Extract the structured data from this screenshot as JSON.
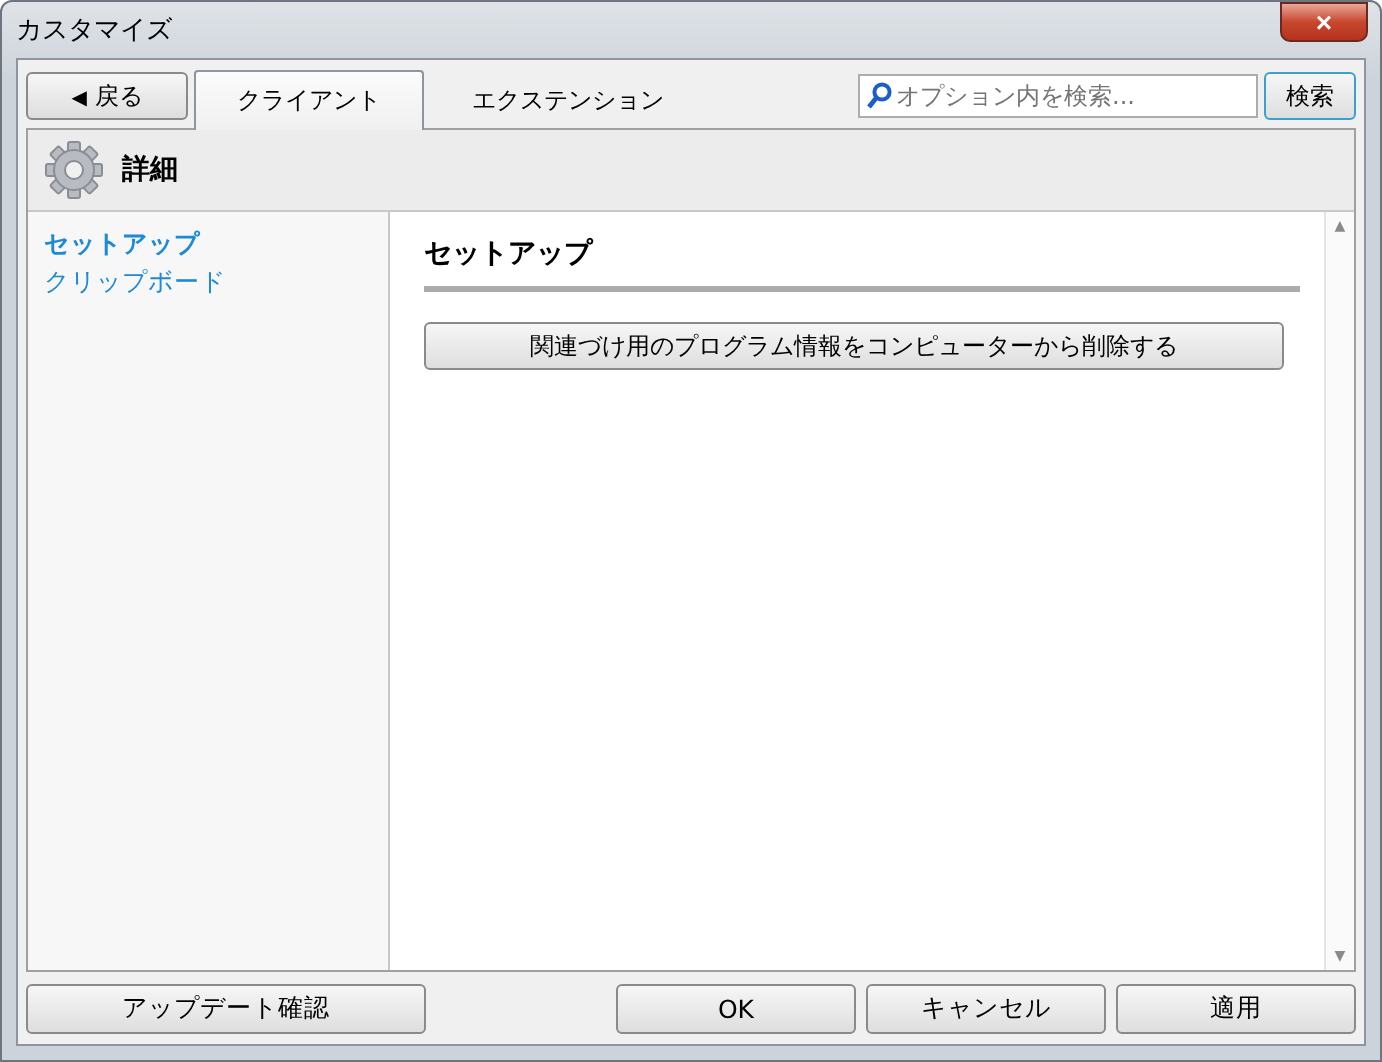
{
  "window": {
    "title": "カスタマイズ",
    "close": "×"
  },
  "back_button": {
    "arrow": "◀",
    "label": "戻る"
  },
  "tabs": [
    {
      "label": "クライアント",
      "selected": true
    },
    {
      "label": "エクステンション",
      "selected": false
    }
  ],
  "search": {
    "placeholder": "オプション内を検索...",
    "button": "検索"
  },
  "section_header": {
    "title": "詳細"
  },
  "sidebar": {
    "items": [
      {
        "label": "セットアップ",
        "selected": true
      },
      {
        "label": "クリップボード",
        "selected": false
      }
    ]
  },
  "content": {
    "heading": "セットアップ",
    "action_button": "関連づけ用のプログラム情報をコンピューターから削除する"
  },
  "scrollbar": {
    "up": "▲",
    "down": "▼"
  },
  "footer": {
    "update_button": "アップデート確認",
    "buttons": [
      "OK",
      "キャンセル",
      "適用"
    ]
  }
}
